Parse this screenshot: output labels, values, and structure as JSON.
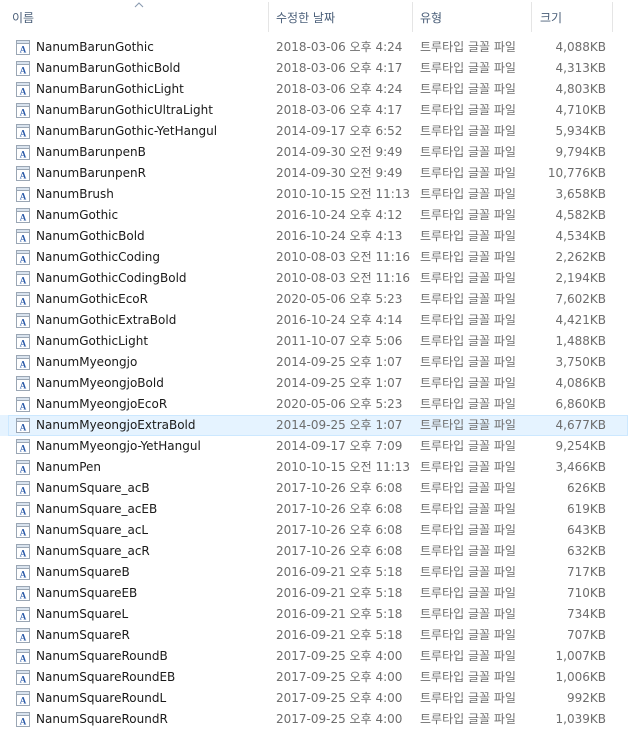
{
  "columns": {
    "name": "이름",
    "date": "수정한 날짜",
    "type": "유형",
    "size": "크기"
  },
  "colors": {
    "header_text": "#4c607a",
    "selected_bg": "#e5f3ff",
    "selected_border": "#cce8ff",
    "secondary_text": "#6d6d6d"
  },
  "selected_file": "NanumMyeongjoExtraBold",
  "files": [
    {
      "name": "NanumBarunGothic",
      "date": "2018-03-06 오후 4:24",
      "type": "트루타입 글꼴 파일",
      "size": "4,088KB"
    },
    {
      "name": "NanumBarunGothicBold",
      "date": "2018-03-06 오후 4:17",
      "type": "트루타입 글꼴 파일",
      "size": "4,313KB"
    },
    {
      "name": "NanumBarunGothicLight",
      "date": "2018-03-06 오후 4:24",
      "type": "트루타입 글꼴 파일",
      "size": "4,803KB"
    },
    {
      "name": "NanumBarunGothicUltraLight",
      "date": "2018-03-06 오후 4:17",
      "type": "트루타입 글꼴 파일",
      "size": "4,710KB"
    },
    {
      "name": "NanumBarunGothic-YetHangul",
      "date": "2014-09-17 오후 6:52",
      "type": "트루타입 글꼴 파일",
      "size": "5,934KB"
    },
    {
      "name": "NanumBarunpenB",
      "date": "2014-09-30 오전 9:49",
      "type": "트루타입 글꼴 파일",
      "size": "9,794KB"
    },
    {
      "name": "NanumBarunpenR",
      "date": "2014-09-30 오전 9:49",
      "type": "트루타입 글꼴 파일",
      "size": "10,776KB"
    },
    {
      "name": "NanumBrush",
      "date": "2010-10-15 오전 11:13",
      "type": "트루타입 글꼴 파일",
      "size": "3,658KB"
    },
    {
      "name": "NanumGothic",
      "date": "2016-10-24 오후 4:12",
      "type": "트루타입 글꼴 파일",
      "size": "4,582KB"
    },
    {
      "name": "NanumGothicBold",
      "date": "2016-10-24 오후 4:13",
      "type": "트루타입 글꼴 파일",
      "size": "4,534KB"
    },
    {
      "name": "NanumGothicCoding",
      "date": "2010-08-03 오전 11:16",
      "type": "트루타입 글꼴 파일",
      "size": "2,262KB"
    },
    {
      "name": "NanumGothicCodingBold",
      "date": "2010-08-03 오전 11:16",
      "type": "트루타입 글꼴 파일",
      "size": "2,194KB"
    },
    {
      "name": "NanumGothicEcoR",
      "date": "2020-05-06 오후 5:23",
      "type": "트루타입 글꼴 파일",
      "size": "7,602KB"
    },
    {
      "name": "NanumGothicExtraBold",
      "date": "2016-10-24 오후 4:14",
      "type": "트루타입 글꼴 파일",
      "size": "4,421KB"
    },
    {
      "name": "NanumGothicLight",
      "date": "2011-10-07 오후 5:06",
      "type": "트루타입 글꼴 파일",
      "size": "1,488KB"
    },
    {
      "name": "NanumMyeongjo",
      "date": "2014-09-25 오후 1:07",
      "type": "트루타입 글꼴 파일",
      "size": "3,750KB"
    },
    {
      "name": "NanumMyeongjoBold",
      "date": "2014-09-25 오후 1:07",
      "type": "트루타입 글꼴 파일",
      "size": "4,086KB"
    },
    {
      "name": "NanumMyeongjoEcoR",
      "date": "2020-05-06 오후 5:23",
      "type": "트루타입 글꼴 파일",
      "size": "6,860KB"
    },
    {
      "name": "NanumMyeongjoExtraBold",
      "date": "2014-09-25 오후 1:07",
      "type": "트루타입 글꼴 파일",
      "size": "4,677KB"
    },
    {
      "name": "NanumMyeongjo-YetHangul",
      "date": "2014-09-17 오후 7:09",
      "type": "트루타입 글꼴 파일",
      "size": "9,254KB"
    },
    {
      "name": "NanumPen",
      "date": "2010-10-15 오전 11:13",
      "type": "트루타입 글꼴 파일",
      "size": "3,466KB"
    },
    {
      "name": "NanumSquare_acB",
      "date": "2017-10-26 오후 6:08",
      "type": "트루타입 글꼴 파일",
      "size": "626KB"
    },
    {
      "name": "NanumSquare_acEB",
      "date": "2017-10-26 오후 6:08",
      "type": "트루타입 글꼴 파일",
      "size": "619KB"
    },
    {
      "name": "NanumSquare_acL",
      "date": "2017-10-26 오후 6:08",
      "type": "트루타입 글꼴 파일",
      "size": "643KB"
    },
    {
      "name": "NanumSquare_acR",
      "date": "2017-10-26 오후 6:08",
      "type": "트루타입 글꼴 파일",
      "size": "632KB"
    },
    {
      "name": "NanumSquareB",
      "date": "2016-09-21 오후 5:18",
      "type": "트루타입 글꼴 파일",
      "size": "717KB"
    },
    {
      "name": "NanumSquareEB",
      "date": "2016-09-21 오후 5:18",
      "type": "트루타입 글꼴 파일",
      "size": "710KB"
    },
    {
      "name": "NanumSquareL",
      "date": "2016-09-21 오후 5:18",
      "type": "트루타입 글꼴 파일",
      "size": "734KB"
    },
    {
      "name": "NanumSquareR",
      "date": "2016-09-21 오후 5:18",
      "type": "트루타입 글꼴 파일",
      "size": "707KB"
    },
    {
      "name": "NanumSquareRoundB",
      "date": "2017-09-25 오후 4:00",
      "type": "트루타입 글꼴 파일",
      "size": "1,007KB"
    },
    {
      "name": "NanumSquareRoundEB",
      "date": "2017-09-25 오후 4:00",
      "type": "트루타입 글꼴 파일",
      "size": "1,006KB"
    },
    {
      "name": "NanumSquareRoundL",
      "date": "2017-09-25 오후 4:00",
      "type": "트루타입 글꼴 파일",
      "size": "992KB"
    },
    {
      "name": "NanumSquareRoundR",
      "date": "2017-09-25 오후 4:00",
      "type": "트루타입 글꼴 파일",
      "size": "1,039KB"
    }
  ]
}
